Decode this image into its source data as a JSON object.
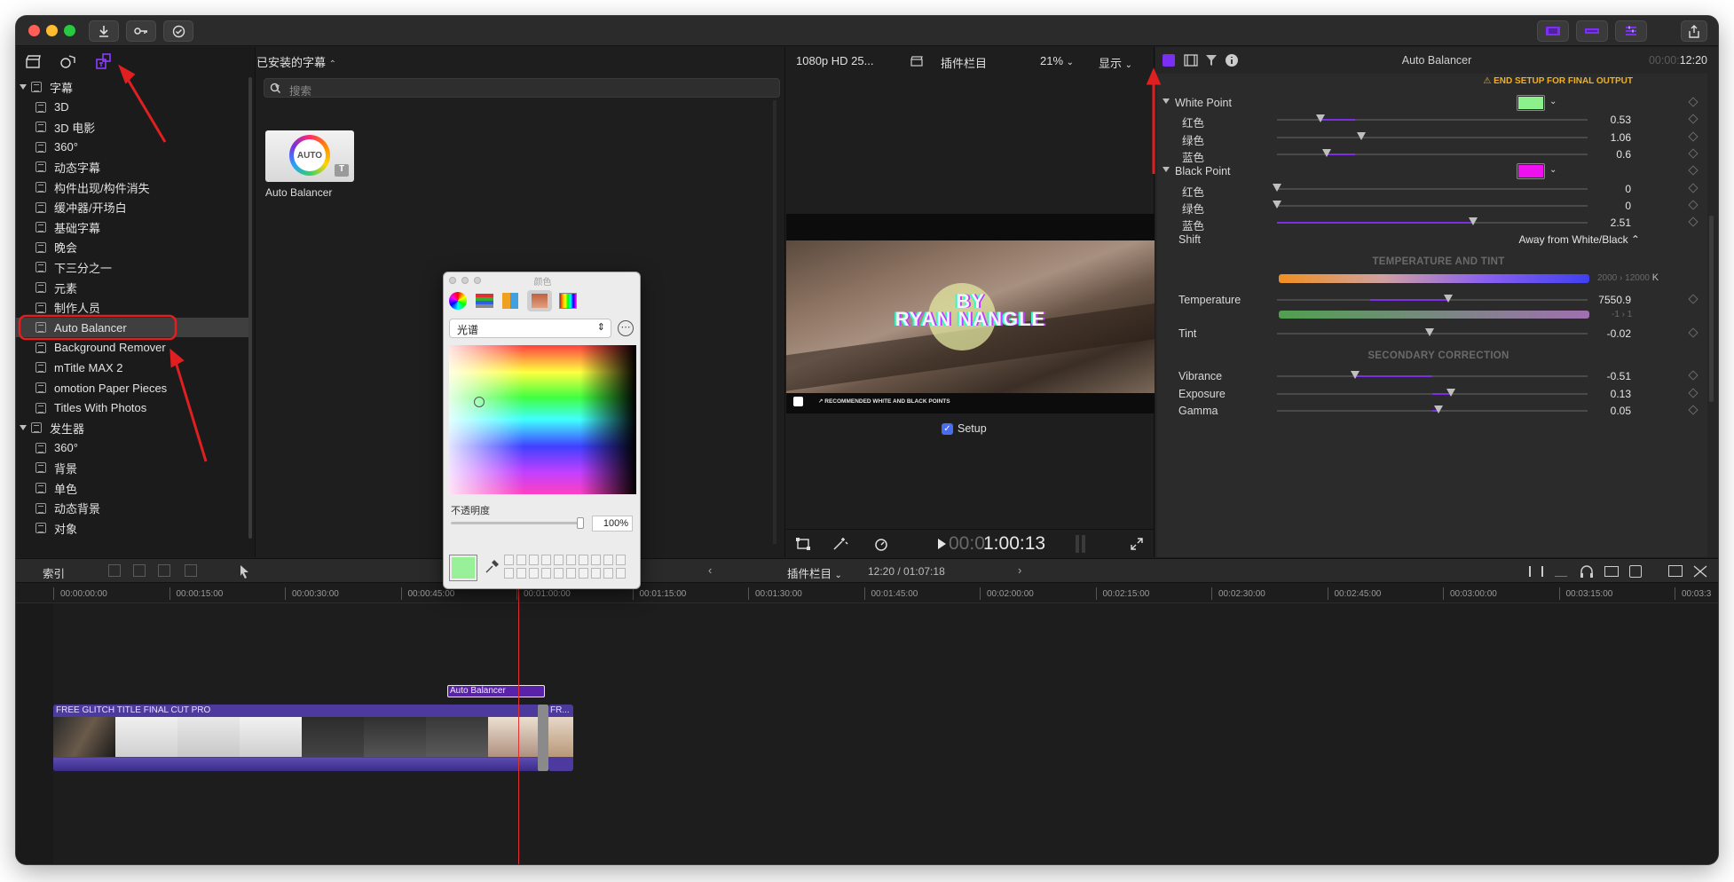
{
  "titlebar": {
    "buttons": [
      "download-icon",
      "key-icon",
      "check-circle-icon"
    ],
    "right_buttons": [
      "layout-browser-icon",
      "layout-timeline-icon",
      "layout-inspector-icon"
    ],
    "share": "share-icon"
  },
  "library": {
    "tabs": [
      "clapper-icon",
      "music-icon",
      "titles-icon"
    ],
    "sections": [
      {
        "label": "字幕",
        "items": [
          "3D",
          "3D 电影",
          "360°",
          "动态字幕",
          "构件出现/构件消失",
          "缓冲器/开场白",
          "基础字幕",
          "晚会",
          "下三分之一",
          "元素",
          "制作人员",
          "Auto Balancer",
          "Background Remover",
          "mTitle MAX 2",
          "omotion Paper Pieces",
          "Titles With Photos"
        ]
      },
      {
        "label": "发生器",
        "items": [
          "360°",
          "背景",
          "单色",
          "动态背景",
          "对象"
        ]
      }
    ],
    "selected": "Auto Balancer"
  },
  "browser": {
    "header": "已安装的字幕",
    "search_placeholder": "搜索",
    "thumb_badge": "AUTO",
    "thumb_label": "Auto Balancer"
  },
  "viewer": {
    "format": "1080p HD 25...",
    "clip_name": "插件栏目",
    "zoom": "21%",
    "view_menu": "显示",
    "title_line1": "BY",
    "title_line2": "RYAN NANGLE",
    "overlay_note": "RECOMMENDED WHITE AND BLACK POINTS",
    "setup_label": "Setup",
    "timecode_dim": "00:0",
    "timecode": "1:00:13"
  },
  "inspector": {
    "title": "Auto Balancer",
    "time_dim": "00:00:",
    "time": "12:20",
    "warning": "⚠ END SETUP FOR FINAL OUTPUT",
    "white_point": {
      "label": "White Point",
      "color": "#8cf08c",
      "rows": [
        {
          "label": "红色",
          "value": "0.53",
          "pos": 0.14,
          "fill_from": 0.14,
          "fill_to": 0.25
        },
        {
          "label": "绿色",
          "value": "1.06",
          "pos": 0.27,
          "fill_from": 0.27,
          "fill_to": 0.27
        },
        {
          "label": "蓝色",
          "value": "0.6",
          "pos": 0.16,
          "fill_from": 0.16,
          "fill_to": 0.25
        }
      ]
    },
    "black_point": {
      "label": "Black Point",
      "color": "#ee10ee",
      "rows": [
        {
          "label": "红色",
          "value": "0",
          "pos": 0.0,
          "fill_from": 0,
          "fill_to": 0
        },
        {
          "label": "绿色",
          "value": "0",
          "pos": 0.0,
          "fill_from": 0,
          "fill_to": 0
        },
        {
          "label": "蓝色",
          "value": "2.51",
          "pos": 0.63,
          "fill_from": 0.0,
          "fill_to": 0.63
        }
      ]
    },
    "shift": {
      "label": "Shift",
      "value": "Away from White/Black"
    },
    "temp_section": "TEMPERATURE AND TINT",
    "temp_range": "2000 › 12000",
    "temp_unit": "K",
    "temperature": {
      "label": "Temperature",
      "value": "7550.9",
      "pos": 0.55,
      "fill_from": 0.3,
      "fill_to": 0.55
    },
    "tint_range": "-1 › 1",
    "tint": {
      "label": "Tint",
      "value": "-0.02",
      "pos": 0.49
    },
    "secondary_section": "SECONDARY CORRECTION",
    "vibrance": {
      "label": "Vibrance",
      "value": "-0.51",
      "pos": 0.25,
      "fill_from": 0.25,
      "fill_to": 0.5
    },
    "exposure": {
      "label": "Exposure",
      "value": "0.13",
      "pos": 0.56,
      "fill_from": 0.5,
      "fill_to": 0.56
    },
    "gamma": {
      "label": "Gamma",
      "value": "0.05",
      "pos": 0.52,
      "fill_from": 0.5,
      "fill_to": 0.52
    }
  },
  "toolbar": {
    "index": "索引",
    "project": "插件栏目",
    "duration": "12:20 / 01:07:18"
  },
  "timeline": {
    "ruler": [
      "00:00:00:00",
      "00:00:15:00",
      "00:00:30:00",
      "00:00:45:00",
      "00:01:00:00",
      "00:01:15:00",
      "00:01:30:00",
      "00:01:45:00",
      "00:02:00:00",
      "00:02:15:00",
      "00:02:30:00",
      "00:02:45:00",
      "00:03:00:00",
      "00:03:15:00",
      "00:03:3"
    ],
    "title_clip": "Auto Balancer",
    "main_clip": "FREE GLITCH TITLE  FINAL CUT PRO",
    "second_clip": "FR..."
  },
  "color_panel": {
    "title": "颜色",
    "mode": "光谱",
    "opacity_label": "不透明度",
    "opacity_value": "100%",
    "selected_color": "#98f098"
  }
}
